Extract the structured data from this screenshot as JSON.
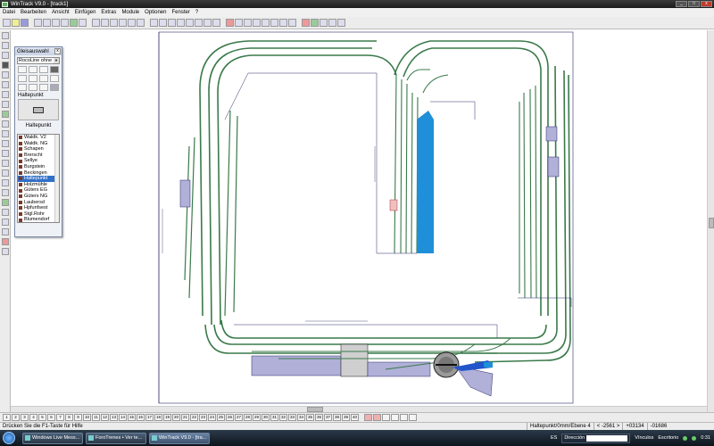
{
  "window": {
    "title": "WinTrack  V9.0 - [track1]",
    "buttons": [
      "_",
      "□",
      "x"
    ]
  },
  "menu": [
    "Datei",
    "Bearbeiten",
    "Ansicht",
    "Einfügen",
    "Extras",
    "Module",
    "Optionen",
    "Fenster",
    "?"
  ],
  "palette": {
    "title": "Gleisauswahl",
    "close": "x",
    "dropdown_value": "RocoLine ohne",
    "selected_caption": "Haltepunkt",
    "preview_label": "Haltepunkt",
    "list": [
      {
        "label": "Waldk. V2",
        "selected": false
      },
      {
        "label": "Waldk. NG",
        "selected": false
      },
      {
        "label": "Schapen",
        "selected": false
      },
      {
        "label": "Brerscht",
        "selected": false
      },
      {
        "label": "Sellye",
        "selected": false
      },
      {
        "label": "Burgstein",
        "selected": false
      },
      {
        "label": "Beckingen",
        "selected": false
      },
      {
        "label": "Haltepunkt",
        "selected": true
      },
      {
        "label": "Holzmühle",
        "selected": false
      },
      {
        "label": "Güters EG",
        "selected": false
      },
      {
        "label": "Güters NG",
        "selected": false
      },
      {
        "label": "Laubersd",
        "selected": false
      },
      {
        "label": "Hpfunfsest",
        "selected": false
      },
      {
        "label": "Stgl.Rohr",
        "selected": false
      },
      {
        "label": "Blumendorf",
        "selected": false
      }
    ]
  },
  "layer_tabs": [
    "1",
    "2",
    "3",
    "4",
    "5",
    "6",
    "7",
    "8",
    "9",
    "10",
    "11",
    "12",
    "13",
    "14",
    "15",
    "16",
    "17",
    "18",
    "19",
    "20",
    "21",
    "22",
    "23",
    "24",
    "25",
    "26",
    "27",
    "28",
    "29",
    "30",
    "31",
    "32",
    "33",
    "34",
    "35",
    "36",
    "37",
    "38",
    "39",
    "40"
  ],
  "status": {
    "hint": "Drücken Sie die  F1-Taste für Hilfe",
    "selection": "Haltepunkt/0mm/Ebene 4",
    "x": "< -2561 >",
    "y": "+03134",
    "z": "-01686"
  },
  "taskbar": {
    "tasks": [
      {
        "label": "Windows Live Mess...",
        "active": false
      },
      {
        "label": "ForoTrenes • Ver te...",
        "active": false
      },
      {
        "label": "WinTrack  V9.0 - [tra...",
        "active": true
      }
    ],
    "lang": "ES",
    "address_label": "Dirección",
    "links_label": "Vínculos",
    "desktop_label": "Escritorio",
    "clock": "0:31"
  },
  "colors": {
    "track": "#3a7a4a",
    "platform": "#1e8fd8",
    "building": "#b0b0d8",
    "outline": "#2b2b6b"
  }
}
